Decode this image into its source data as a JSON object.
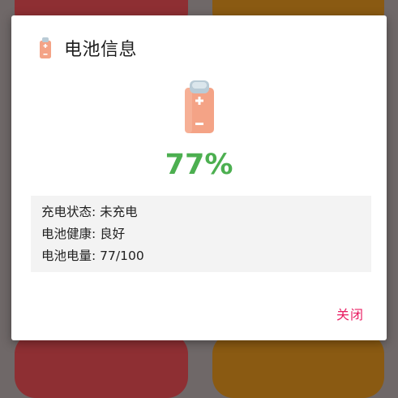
{
  "dialog": {
    "title": "电池信息",
    "title_icon": "battery-icon",
    "main_icon": "battery-icon",
    "percent": "77%",
    "info": [
      "充电状态: 未充电",
      "电池健康: 良好",
      "电池电量: 77/100"
    ],
    "close_label": "关闭"
  },
  "colors": {
    "percent": "#4caf50",
    "close": "#e91e63",
    "battery_body": "#f4a386",
    "battery_cap": "#b9cbd6",
    "background_card_red": "#8e2f33",
    "background_card_orange": "#8a5a12"
  },
  "battery_level": 0.77
}
